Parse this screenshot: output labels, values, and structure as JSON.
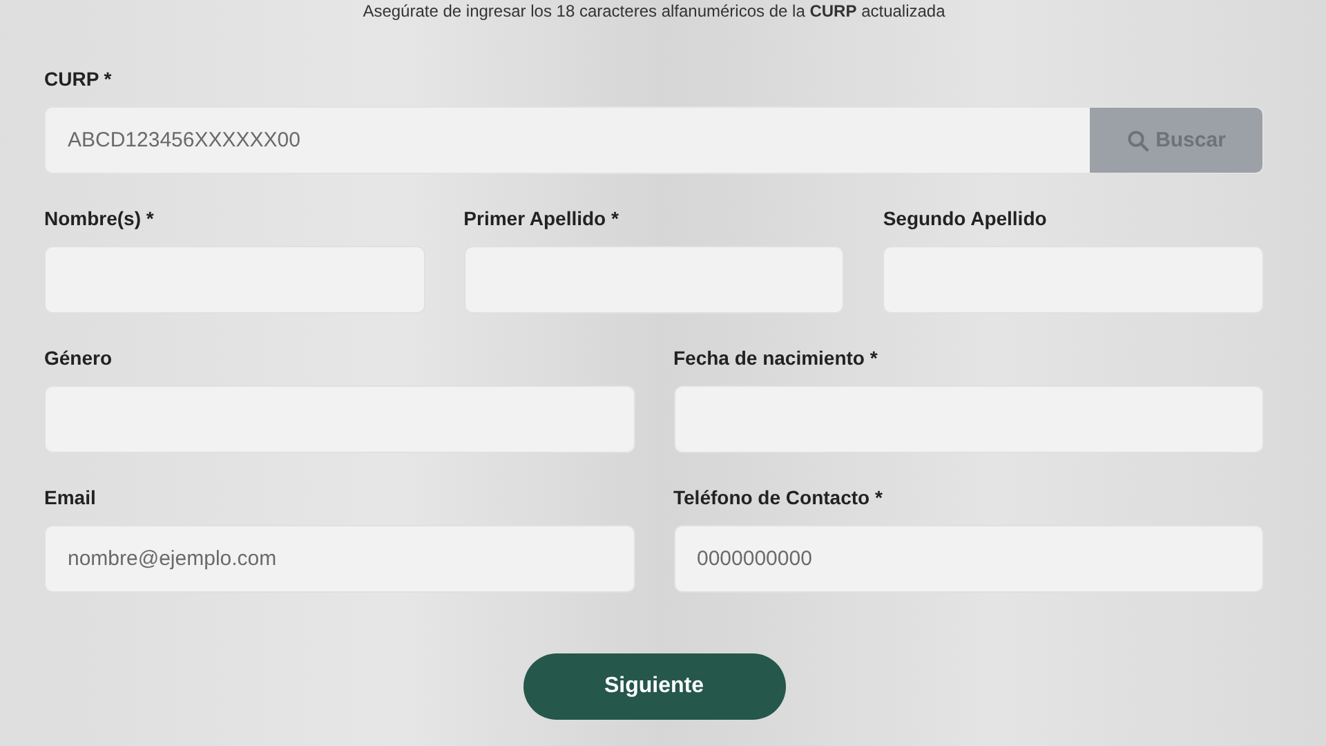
{
  "notice": "Asegúrate de ingresar los 18 caracteres alfanuméricos de la **CURP** actualizada",
  "curp": {
    "label": "CURP *",
    "placeholder": "ABCD123456XXXXXX00",
    "button": {
      "label": "Buscar",
      "disabled": true
    }
  },
  "rows": [
    [
      {
        "label": "Nombre(s) *"
      },
      {
        "label": "Primer Apellido *"
      },
      {
        "label": "Segundo Apellido"
      }
    ],
    [
      {
        "label": "Género"
      },
      {
        "label": "Fecha de nacimiento *"
      }
    ],
    [
      {
        "label": "Email",
        "placeholder": "nombre@ejemplo.com"
      },
      {
        "label": "Teléfono de Contacto *",
        "placeholder": "0000000000"
      }
    ]
  ],
  "submit": "Siguiente"
}
